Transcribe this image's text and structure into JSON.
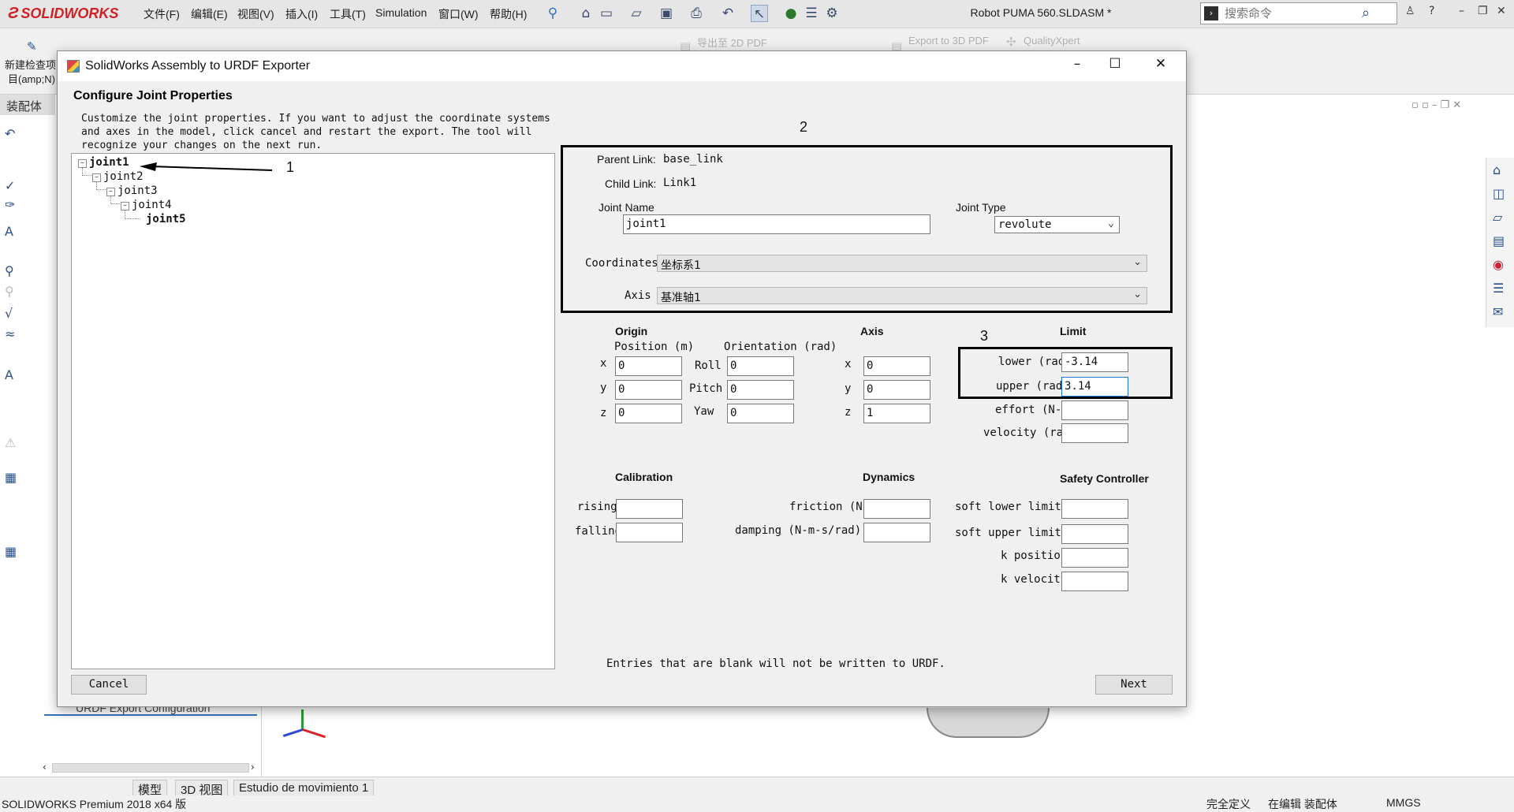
{
  "app": {
    "logo": "SOLIDWORKS",
    "menu": [
      "文件(F)",
      "编辑(E)",
      "视图(V)",
      "插入(I)",
      "工具(T)",
      "Simulation",
      "窗口(W)",
      "帮助(H)"
    ],
    "document_title": "Robot PUMA 560.SLDASM *",
    "search_placeholder": "搜索命令"
  },
  "command_manager": {
    "export_2d_pdf": "导出至 2D PDF",
    "export_3d_pdf": "Export to 3D PDF",
    "quality_xpert": "QualityXpert",
    "left_tool_label_1": "新建检查项",
    "left_tool_label_2": "目(amp;N)"
  },
  "left_panel": {
    "tab_label": "装配体",
    "hidden_item": "URDF Export Configuration"
  },
  "bottom_tabs": [
    "模型",
    "3D 视图",
    "Estudio de movimiento 1"
  ],
  "status_bar": {
    "product": "SOLIDWORKS Premium 2018 x64 版",
    "state": "完全定义",
    "editing": "在编辑 装配体",
    "units": "MMGS"
  },
  "dialog": {
    "title": "SolidWorks Assembly to URDF Exporter",
    "heading": "Configure Joint Properties",
    "description_lines": [
      "Customize the joint properties. If you want to adjust the coordinate systems",
      "and axes in the model, click cancel and restart the export. The tool will",
      "recognize your changes on the next run."
    ],
    "tree": [
      "joint1",
      "joint2",
      "joint3",
      "joint4",
      "joint5"
    ],
    "markers": [
      "1",
      "2",
      "3"
    ],
    "link_section": {
      "parent_link_label": "Parent Link:",
      "parent_link_value": "base_link",
      "child_link_label": "Child Link:",
      "child_link_value": "Link1",
      "joint_name_label": "Joint Name",
      "joint_name_value": "joint1",
      "joint_type_label": "Joint Type",
      "joint_type_value": "revolute",
      "coordinates_label": "Coordinates",
      "coordinates_value": "坐标系1",
      "axis_label": "Axis",
      "axis_value": "基准轴1"
    },
    "origin": {
      "title": "Origin",
      "position_label": "Position (m)",
      "orientation_label": "Orientation (rad)",
      "x_label": "x",
      "y_label": "y",
      "z_label": "z",
      "x": "0",
      "y": "0",
      "z": "0",
      "roll_label": "Roll",
      "pitch_label": "Pitch",
      "yaw_label": "Yaw",
      "roll": "0",
      "pitch": "0",
      "yaw": "0"
    },
    "axis": {
      "title": "Axis",
      "x_label": "x",
      "y_label": "y",
      "z_label": "z",
      "x": "0",
      "y": "0",
      "z": "1"
    },
    "limit": {
      "title": "Limit",
      "lower_label": "lower (rad",
      "lower": "-3.14",
      "upper_label": "upper (rad)",
      "upper": "3.14",
      "effort_label": "effort (N-m",
      "effort": "",
      "velocity_label": "velocity (rad",
      "velocity": ""
    },
    "calibration": {
      "title": "Calibration",
      "rising_label": "rising",
      "rising": "",
      "falling_label": "falling",
      "falling": ""
    },
    "dynamics": {
      "title": "Dynamics",
      "friction_label": "friction (N-",
      "friction": "",
      "damping_label": "damping (N-m-s/rad)",
      "damping": ""
    },
    "safety": {
      "title": "Safety Controller",
      "soft_lower_label": "soft lower limit",
      "soft_lower": "",
      "soft_upper_label": "soft upper limit",
      "soft_upper": "",
      "k_position_label": "k position",
      "k_position": "",
      "k_velocity_label": "k velocity",
      "k_velocity": ""
    },
    "footer_note": "Entries that are blank will not be written to URDF.",
    "cancel_label": "Cancel",
    "next_label": "Next"
  }
}
